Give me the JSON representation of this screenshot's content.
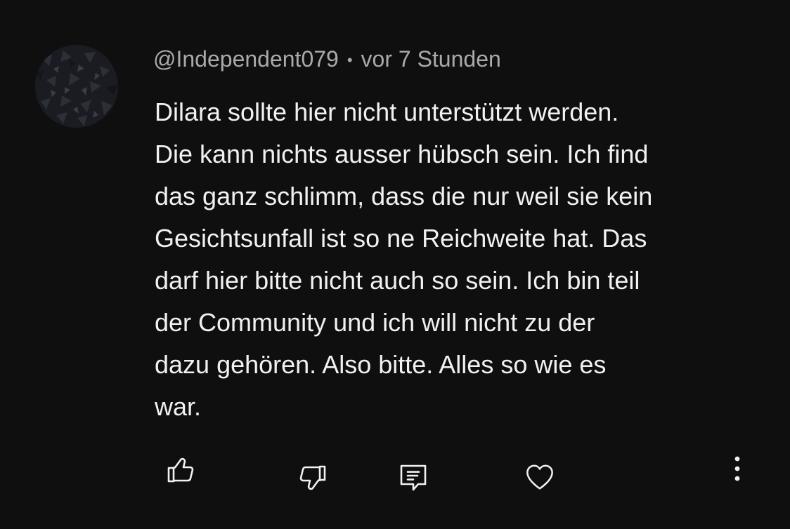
{
  "comment": {
    "author": "@Independent079",
    "separator": "•",
    "timestamp": "vor 7 Stunden",
    "text_lines": [
      "Dilara sollte hier nicht unterstützt werden.",
      "Die kann nichts ausser hübsch sein. Ich find",
      "das ganz schlimm, dass die nur weil sie kein",
      "Gesichtsunfall ist so ne Reichweite hat. Das",
      "darf hier bitte nicht auch so sein. Ich bin teil",
      "der Community und ich will nicht zu der",
      "dazu gehören. Also bitte. Alles so wie es",
      "war."
    ]
  },
  "actions": {
    "like_icon": "thumbs-up-icon",
    "dislike_icon": "thumbs-down-icon",
    "reply_icon": "comment-icon",
    "heart_icon": "heart-icon",
    "more_icon": "more-vertical-icon"
  },
  "colors": {
    "background": "#0f0f0f",
    "text": "#f1f1f1",
    "meta": "#aaaaaa",
    "icon": "#f1f1f1"
  }
}
